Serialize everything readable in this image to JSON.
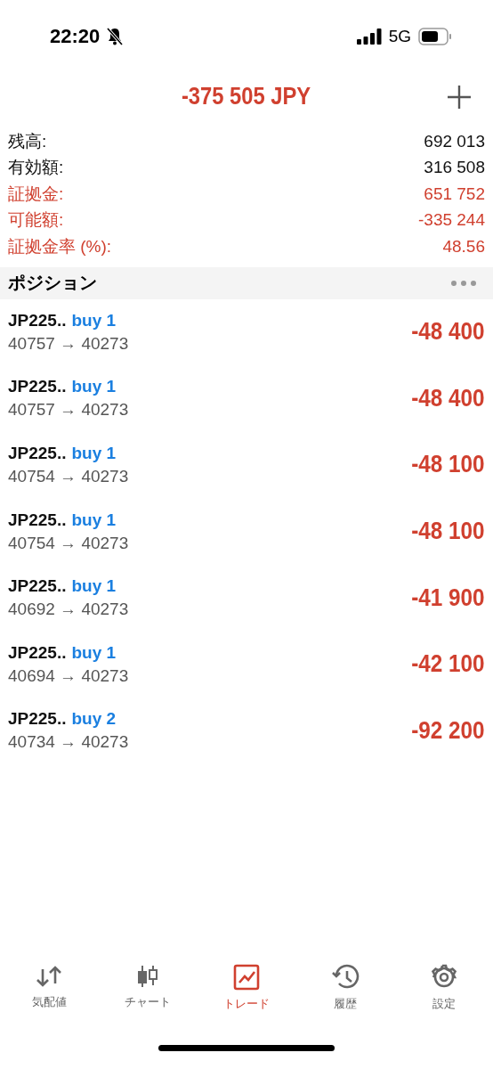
{
  "status_bar": {
    "time": "22:20",
    "network": "5G"
  },
  "header": {
    "title": "-375 505 JPY"
  },
  "summary": [
    {
      "label": "残高:",
      "value": "692 013",
      "color": "#111111"
    },
    {
      "label": "有効額:",
      "value": "316 508",
      "color": "#111111"
    },
    {
      "label": "証拠金:",
      "value": "651 752",
      "color": "#d0402f"
    },
    {
      "label": "可能額:",
      "value": "-335 244",
      "color": "#d0402f"
    },
    {
      "label": "証拠金率 (%):",
      "value": "48.56",
      "color": "#d0402f"
    }
  ],
  "section": {
    "title": "ポジション"
  },
  "positions": [
    {
      "symbol": "JP225..",
      "side": "buy 1",
      "prices": "40757 → 40273",
      "profit": "-48 400"
    },
    {
      "symbol": "JP225..",
      "side": "buy 1",
      "prices": "40757 → 40273",
      "profit": "-48 400"
    },
    {
      "symbol": "JP225..",
      "side": "buy 1",
      "prices": "40754 → 40273",
      "profit": "-48 100"
    },
    {
      "symbol": "JP225..",
      "side": "buy 1",
      "prices": "40754 → 40273",
      "profit": "-48 100"
    },
    {
      "symbol": "JP225..",
      "side": "buy 1",
      "prices": "40692 → 40273",
      "profit": "-41 900"
    },
    {
      "symbol": "JP225..",
      "side": "buy 1",
      "prices": "40694 → 40273",
      "profit": "-42 100"
    },
    {
      "symbol": "JP225..",
      "side": "buy 2",
      "prices": "40734 → 40273",
      "profit": "-92 200"
    }
  ],
  "tabs": [
    {
      "label": "気配値",
      "selected": false
    },
    {
      "label": "チャート",
      "selected": false
    },
    {
      "label": "トレード",
      "selected": true
    },
    {
      "label": "履歴",
      "selected": false
    },
    {
      "label": "設定",
      "selected": false
    }
  ]
}
